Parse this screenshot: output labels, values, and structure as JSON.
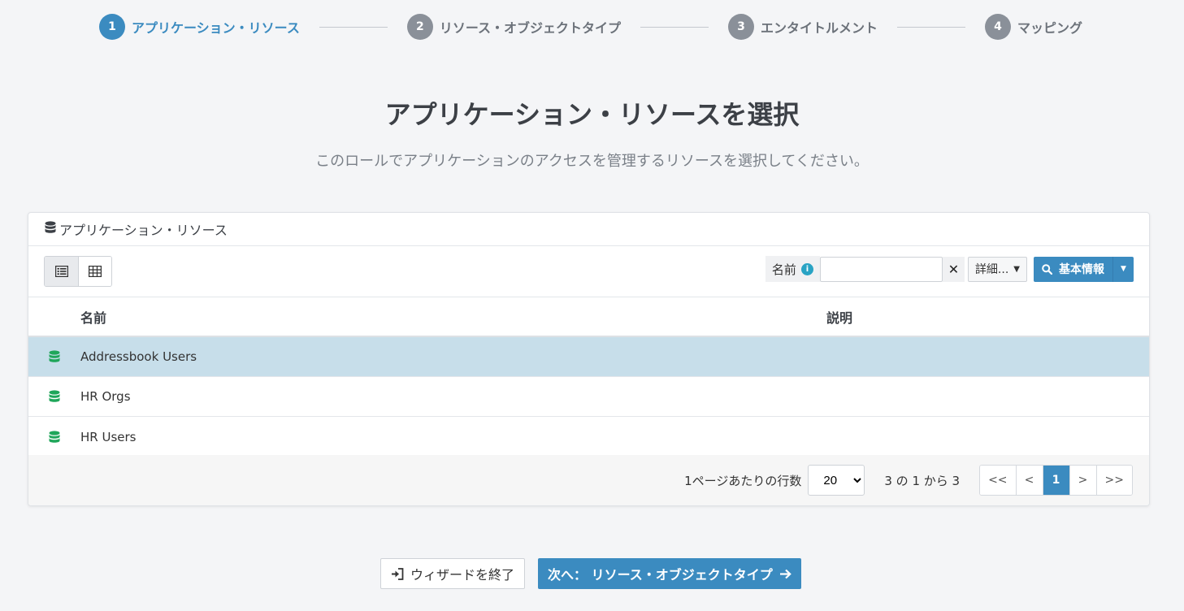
{
  "stepper": {
    "steps": [
      {
        "num": "1",
        "label": "アプリケーション・リソース"
      },
      {
        "num": "2",
        "label": "リソース・オブジェクトタイプ"
      },
      {
        "num": "3",
        "label": "エンタイトルメント"
      },
      {
        "num": "4",
        "label": "マッピング"
      }
    ],
    "active_index": 0
  },
  "page": {
    "title": "アプリケーション・リソースを選択",
    "subtitle": "このロールでアプリケーションのアクセスを管理するリソースを選択してください。"
  },
  "card": {
    "header_title": "アプリケーション・リソース",
    "header_icon": "database-icon"
  },
  "toolbar": {
    "filter_label": "名前",
    "filter_value": "",
    "clear_label": "✕",
    "advanced_label": "詳細...",
    "search_label": "基本情報"
  },
  "table": {
    "columns": [
      "名前",
      "説明"
    ],
    "rows": [
      {
        "name": "Addressbook Users",
        "description": "",
        "selected": true
      },
      {
        "name": "HR Orgs",
        "description": "",
        "selected": false
      },
      {
        "name": "HR Users",
        "description": "",
        "selected": false
      }
    ]
  },
  "footer": {
    "per_page_label": "1ページあたりの行数",
    "per_page_value": "20",
    "range_text": "3 の 1 から 3",
    "pager": {
      "first": "<<",
      "prev": "<",
      "current": "1",
      "next": ">",
      "last": ">>"
    }
  },
  "actions": {
    "exit_label": "ウィザードを終了",
    "next_label": "次へ： リソース・オブジェクトタイプ"
  },
  "colors": {
    "accent": "#3b8bc0",
    "step_inactive": "#8a9099",
    "selected_row": "#c7deea",
    "db_icon_green": "#1fa65a"
  }
}
